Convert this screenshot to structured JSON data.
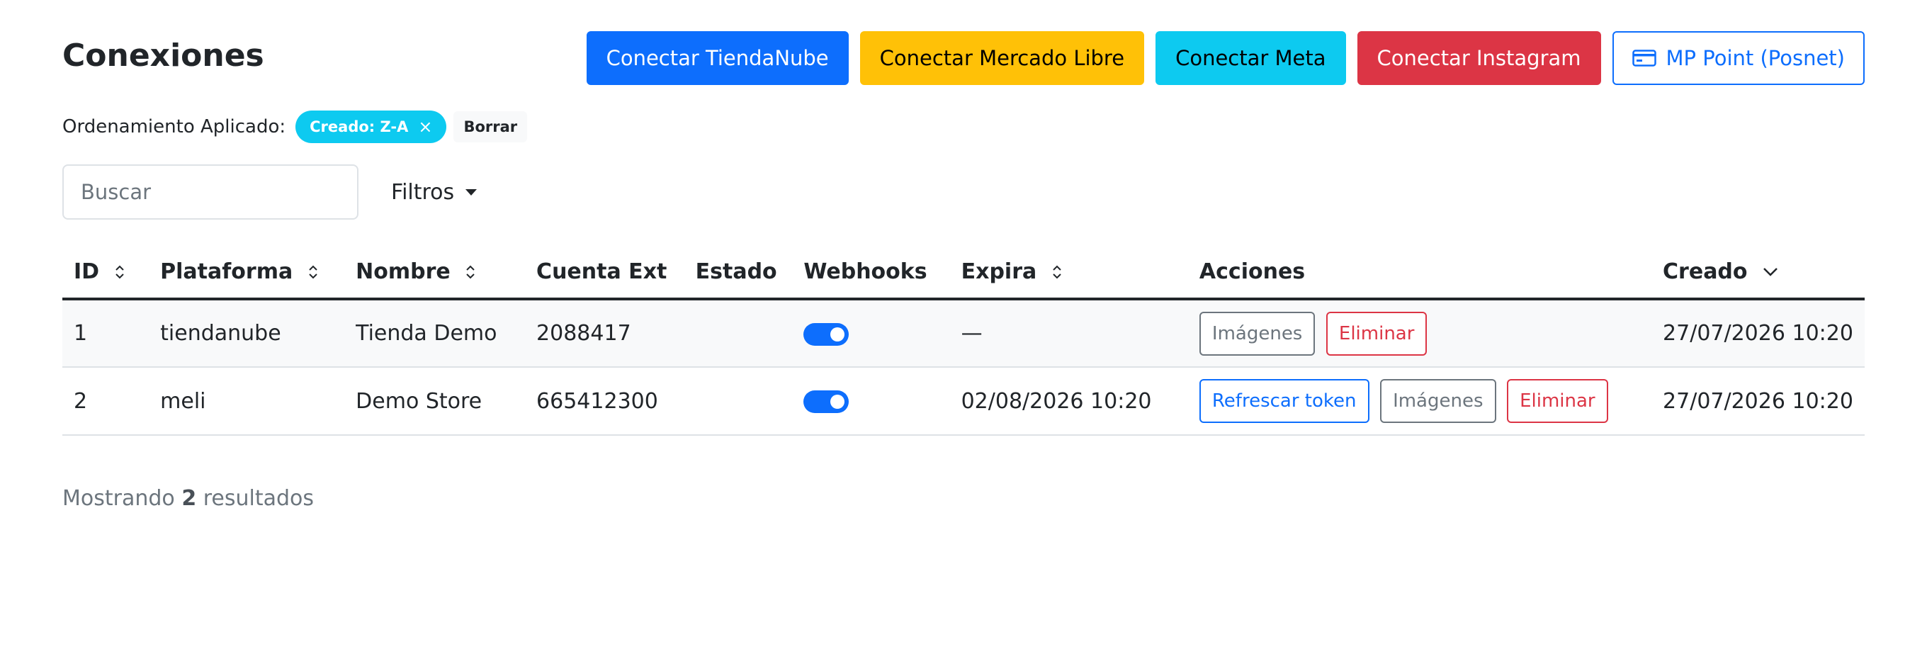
{
  "page": {
    "title": "Conexiones"
  },
  "buttons": {
    "tiendanube": "Conectar TiendaNube",
    "mercadolibre": "Conectar Mercado Libre",
    "meta": "Conectar Meta",
    "instagram": "Conectar Instagram",
    "mppoint": "MP Point (Posnet)"
  },
  "sort": {
    "label": "Ordenamiento Aplicado:",
    "chip": "Creado: Z-A",
    "chip_close": "×",
    "clear": "Borrar"
  },
  "search": {
    "placeholder": "Buscar",
    "filters_label": "Filtros"
  },
  "table": {
    "headers": {
      "id": "ID",
      "platform": "Plataforma",
      "name": "Nombre",
      "account": "Cuenta Ext",
      "status": "Estado",
      "webhooks": "Webhooks",
      "expires": "Expira",
      "actions": "Acciones",
      "created": "Creado"
    },
    "rows": [
      {
        "id": "1",
        "platform": "tiendanube",
        "name": "Tienda Demo",
        "account": "2088417",
        "status": "",
        "webhooks_on": true,
        "expires": "—",
        "actions": {
          "images": "Imágenes",
          "delete": "Eliminar"
        },
        "created": "27/07/2026 10:20"
      },
      {
        "id": "2",
        "platform": "meli",
        "name": "Demo Store",
        "account": "665412300",
        "status": "",
        "webhooks_on": true,
        "expires": "02/08/2026 10:20",
        "actions": {
          "refresh": "Refrescar token",
          "images": "Imágenes",
          "delete": "Eliminar"
        },
        "created": "27/07/2026 10:20"
      }
    ]
  },
  "footer": {
    "prefix": "Mostrando",
    "count": "2",
    "suffix": "resultados"
  },
  "colors": {
    "primary": "#0d6efd",
    "warning": "#ffc107",
    "info": "#0dcaf0",
    "danger": "#dc3545",
    "secondary": "#6c757d"
  },
  "icons": {
    "mppoint": "credit-card-icon",
    "sortable": "sort-icon",
    "sorted": "chevron-down-icon"
  }
}
